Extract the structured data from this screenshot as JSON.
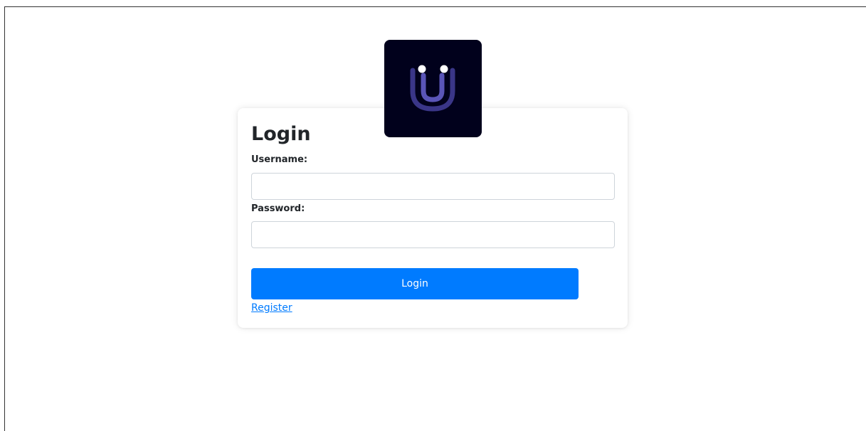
{
  "login": {
    "title": "Login",
    "username_label": "Username:",
    "username_value": "",
    "password_label": "Password:",
    "password_value": "",
    "submit_label": "Login",
    "register_link": "Register"
  },
  "logo": {
    "icon": "smiley-u-logo",
    "background": "#01011c",
    "accent": "#4b46a6"
  },
  "colors": {
    "primary": "#007bff",
    "text": "#212529",
    "input_border": "#ced4da"
  }
}
